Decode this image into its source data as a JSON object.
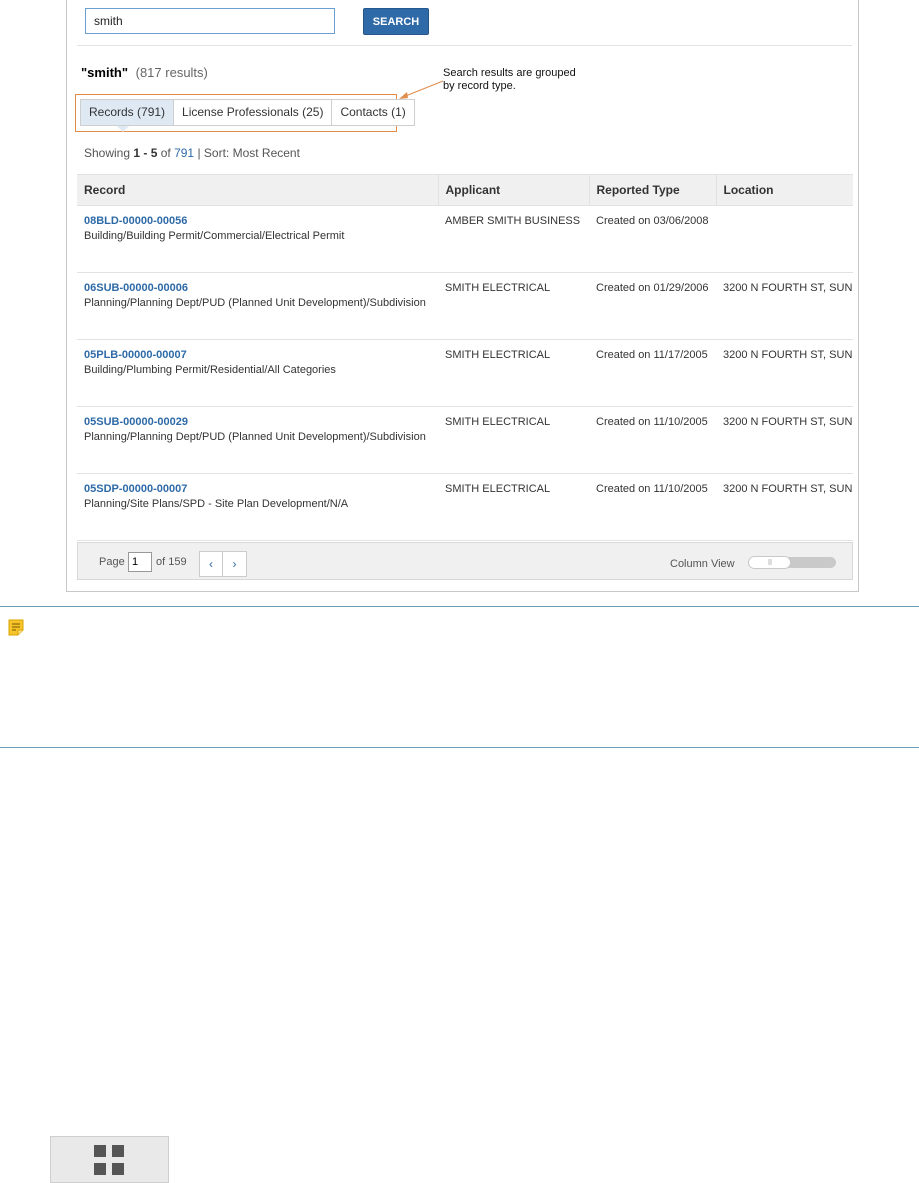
{
  "search": {
    "value": "smith",
    "button_label": "SEARCH"
  },
  "results": {
    "query": "\"smith\"",
    "count_label": "(817 results)"
  },
  "annotation": {
    "text_line1": "Search results are grouped",
    "text_line2": "by record type.",
    "color": "#e08c4a"
  },
  "tabs": [
    {
      "label": "Records (791)",
      "active": true
    },
    {
      "label": "License Professionals (25)",
      "active": false
    },
    {
      "label": "Contacts (1)",
      "active": false
    }
  ],
  "showing": {
    "prefix": "Showing ",
    "range": "1 - 5",
    "of": " of ",
    "total": "791",
    "sort": " | Sort: Most Recent"
  },
  "table": {
    "headers": [
      "Record",
      "Applicant",
      "Reported Type",
      "Location"
    ],
    "rows": [
      {
        "id": "08BLD-00000-00056",
        "desc": "Building/Building Permit/Commercial/Electrical Permit",
        "applicant": "AMBER SMITH BUSINESS",
        "type": "Created on 03/06/2008",
        "location": ""
      },
      {
        "id": "06SUB-00000-00006",
        "desc": "Planning/Planning Dept/PUD (Planned Unit Development)/Subdivision",
        "applicant": "SMITH ELECTRICAL",
        "type": "Created on 01/29/2006",
        "location": "3200 N FOURTH ST, SUN"
      },
      {
        "id": "05PLB-00000-00007",
        "desc": "Building/Plumbing Permit/Residential/All Categories",
        "applicant": "SMITH ELECTRICAL",
        "type": "Created on 11/17/2005",
        "location": "3200 N FOURTH ST, SUN"
      },
      {
        "id": "05SUB-00000-00029",
        "desc": "Planning/Planning Dept/PUD (Planned Unit Development)/Subdivision",
        "applicant": "SMITH ELECTRICAL",
        "type": "Created on 11/10/2005",
        "location": "3200 N FOURTH ST, SUN"
      },
      {
        "id": "05SDP-00000-00007",
        "desc": "Planning/Site Plans/SPD - Site Plan Development/N/A",
        "applicant": "SMITH ELECTRICAL",
        "type": "Created on 11/10/2005",
        "location": "3200 N FOURTH ST, SUN"
      }
    ]
  },
  "pager": {
    "page_label": "Page",
    "page_value": "1",
    "of_label": "of 159",
    "prev": "‹",
    "next": "›",
    "column_view_label": "Column View"
  },
  "icons": {
    "note": "note-icon",
    "grid": "grid-icon"
  },
  "colors": {
    "accent": "#2e6aa7",
    "note_rule": "#6a9fb5",
    "note_icon": "#f0b400"
  }
}
